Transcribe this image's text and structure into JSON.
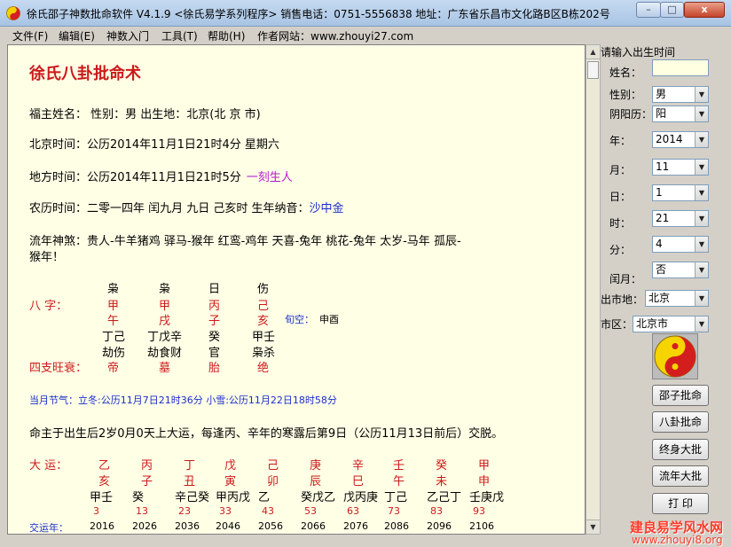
{
  "window": {
    "title": "徐氏邵子神数批命软件 V4.1.9 <徐氏易学系列程序>    销售电话：0751-5556838    地址：广东省乐昌市文化路B区B栋202号",
    "min_label": "–",
    "max_label": "□",
    "close_label": "x"
  },
  "menu": {
    "items": [
      "文件(F)",
      "编辑(E)",
      "神数入门",
      "工具(T)",
      "帮助(H)",
      "作者网站：www.zhouyi27.com"
    ]
  },
  "doc": {
    "heading": "徐氏八卦批命术",
    "line_name": "福主姓名：  性别：男   出生地：北京(北 京 市)",
    "beijing_time": "北京时间：公历2014年11月1日21时4分  星期六",
    "local_time": "地方时间：公历2014年11月1日21时5分",
    "local_time_note": "一刻生人",
    "lunar_time": "农历时间：二零一四年  闰九月  九日  己亥时    生年纳音：",
    "nayin": "沙中金",
    "shensha_1": "流年神煞：贵人-牛羊猪鸡    驿马-猴年    红鸾-鸡年    天喜-兔年    桃花-兔年    太岁-马年    孤辰-",
    "shensha_2": "猴年！",
    "bazi": {
      "label": "八  字：",
      "shishen": [
        "枭",
        "枭",
        "日",
        "伤"
      ],
      "gan": [
        "甲",
        "甲",
        "丙",
        "己"
      ],
      "zhi": [
        "午",
        "戌",
        "子",
        "亥"
      ],
      "xunkong_label": "旬空：",
      "xunkong": "申酉",
      "canggan": [
        "丁己",
        "丁戊辛",
        "癸",
        "甲壬"
      ],
      "canggan_shishen": [
        "劫伤",
        "劫食财",
        "官",
        "枭杀"
      ],
      "wangshuai_label": "四支旺衰：",
      "wangshuai": [
        "帝",
        "墓",
        "胎",
        "绝"
      ]
    },
    "jieqi": "当月节气：立冬:公历11月7日21时36分  小雪:公历11月22日18时58分",
    "qiyun": "命主于出生后2岁0月0天上大运，每逢丙、辛年的寒露后第9日（公历11月13日前后）交脱。",
    "dayun": {
      "label": "大  运：",
      "gan": [
        "乙",
        "丙",
        "丁",
        "戊",
        "己",
        "庚",
        "辛",
        "壬",
        "癸",
        "甲"
      ],
      "zhi": [
        "亥",
        "子",
        "丑",
        "寅",
        "卯",
        "辰",
        "巳",
        "午",
        "未",
        "申"
      ],
      "canggan": [
        "甲壬",
        "癸",
        "辛己癸",
        "甲丙戊",
        "乙",
        "癸戊乙",
        "戊丙庚",
        "丁己",
        "乙己丁",
        "壬庚戊"
      ],
      "ages": [
        "3",
        "13",
        "23",
        "33",
        "43",
        "53",
        "63",
        "73",
        "83",
        "93"
      ],
      "years_label": "交运年：",
      "years": [
        "2016",
        "2026",
        "2036",
        "2046",
        "2056",
        "2066",
        "2076",
        "2086",
        "2096",
        "2106"
      ]
    }
  },
  "panel": {
    "header": "请输入出生时间",
    "name_label": "姓名：",
    "name_value": "",
    "gender_label": "性别：",
    "gender_value": "男",
    "calendar_label": "阴阳历：",
    "calendar_value": "阳",
    "year_label": "年：",
    "year_value": "2014",
    "month_label": "月：",
    "month_value": "11",
    "day_label": "日：",
    "day_value": "1",
    "hour_label": "时：",
    "hour_value": "21",
    "minute_label": "分：",
    "minute_value": "4",
    "leap_label": "闰月：",
    "leap_value": "否",
    "city_label": "出市地：",
    "city_value": "北京",
    "district_label": "市区：",
    "district_value": "北京市",
    "buttons": [
      "邵子批命",
      "八卦批命",
      "终身大批",
      "流年大批",
      "打 印"
    ]
  },
  "watermark": {
    "line1": "建良易学风水网",
    "line2": "www.zhouyi8.org"
  }
}
